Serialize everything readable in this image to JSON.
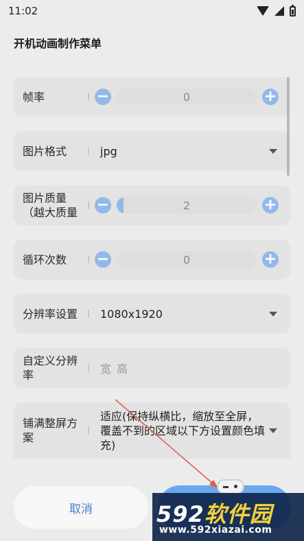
{
  "status_bar": {
    "time": "11:02",
    "icons": [
      "wifi-icon",
      "signal-icon",
      "battery-icon"
    ]
  },
  "menu": {
    "title": "开机动画制作菜单"
  },
  "rows": {
    "frame_rate": {
      "label": "帧率",
      "value": "0"
    },
    "image_format": {
      "label": "图片格式",
      "value": "jpg"
    },
    "image_quality": {
      "label": "图片质量（越大质量",
      "value": "2",
      "level": 0.05
    },
    "loop_count": {
      "label": "循环次数",
      "value": "0"
    },
    "resolution": {
      "label": "分辨率设置",
      "value": "1080x1920"
    },
    "custom_resolution": {
      "label": "自定义分辨率",
      "width_placeholder": "宽",
      "height_placeholder": "高"
    },
    "fill_mode": {
      "label": "铺满整屏方案",
      "value": "适应(保持纵横比，缩放至全屏，覆盖不到的区域以下方设置颜色填充)"
    }
  },
  "buttons": {
    "cancel": "取消"
  },
  "watermark": {
    "logo_a": "592",
    "logo_b": "软件园",
    "url": "www.592xiazai.com"
  },
  "colors": {
    "accent": "#93b9ea",
    "confirm": "#6aa8ec",
    "cancel_text": "#4a7ec6",
    "annotation_arrow": "#e05a4a"
  }
}
